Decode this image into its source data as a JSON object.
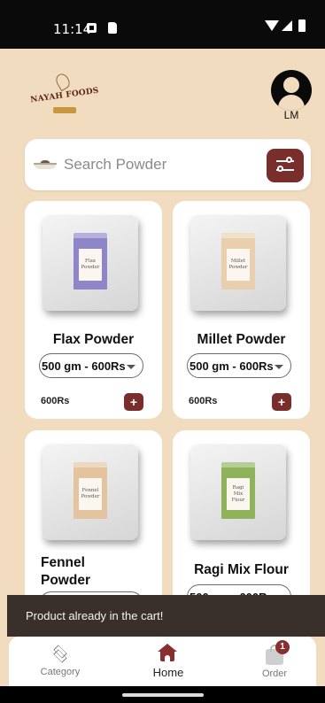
{
  "status_bar": {
    "time": "11:14"
  },
  "header": {
    "brand_logo_text": "NAYAH FOODS",
    "user_initials": "LM"
  },
  "search": {
    "placeholder": "Search Powder"
  },
  "products": [
    {
      "name": "Flax Powder",
      "variant": "500 gm - 600Rs",
      "price": "600Rs",
      "pack_text": "Flax Powder",
      "pack_color": "#8f86c9"
    },
    {
      "name": "Millet Powder",
      "variant": "500 gm - 600Rs",
      "price": "600Rs",
      "pack_text": "Millet Powder",
      "pack_color": "#e9cfae"
    },
    {
      "name": "Fennel Powder",
      "variant": "",
      "price": "",
      "pack_text": "Fennel Powder",
      "pack_color": "#e4c49e"
    },
    {
      "name": "Ragi Mix Flour",
      "variant": "500 gm - 600Rs",
      "price": "",
      "pack_text": "Ragi Mix Flour",
      "pack_color": "#8fb35a"
    }
  ],
  "toast": {
    "message": "Product already in the cart!"
  },
  "bottom_nav": {
    "items": [
      {
        "label": "Category",
        "icon": "layers-icon",
        "active": false
      },
      {
        "label": "Home",
        "icon": "home-icon",
        "active": true
      },
      {
        "label": "Order",
        "icon": "shopping-bag-icon",
        "active": false,
        "badge": "1"
      }
    ]
  },
  "colors": {
    "background": "#f2dcc0",
    "accent": "#7a2e2b",
    "card": "#ffffff",
    "toast": "#3a302b"
  }
}
